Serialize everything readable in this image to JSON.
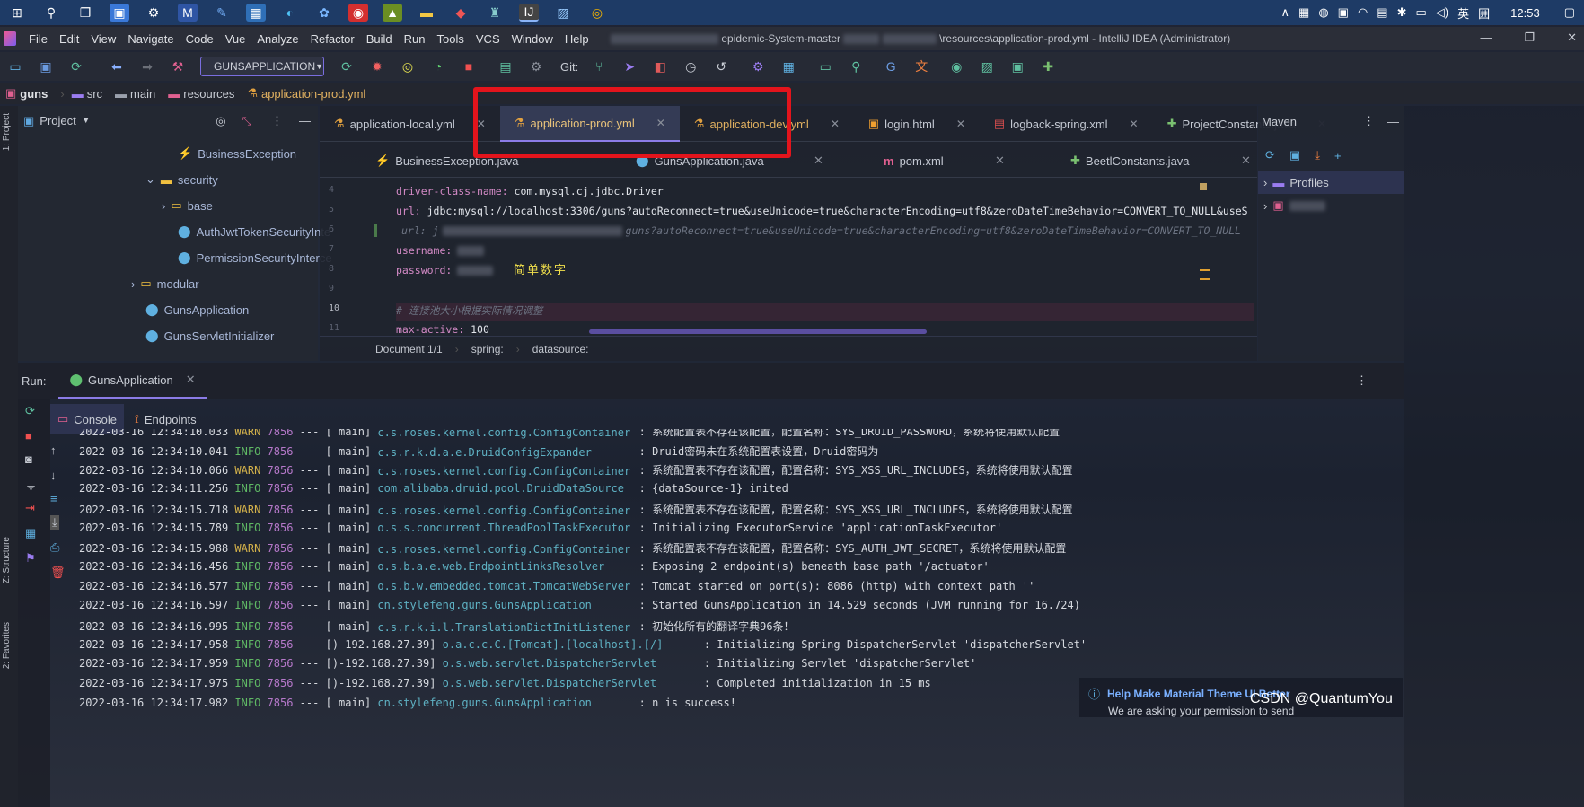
{
  "taskbar": {
    "tray": {
      "ime": "英",
      "time": "12:53"
    }
  },
  "menubar": {
    "items": [
      "File",
      "Edit",
      "View",
      "Navigate",
      "Code",
      "Vue",
      "Analyze",
      "Refactor",
      "Build",
      "Run",
      "Tools",
      "VCS",
      "Window",
      "Help"
    ],
    "title_fragment1": "epidemic-System-master",
    "title_fragment2": "\\resources\\application-prod.yml - IntelliJ IDEA (Administrator)"
  },
  "toolbar": {
    "run_config": "GUNSAPPLICATION",
    "git_label": "Git:"
  },
  "breadcrumb": [
    "guns",
    "src",
    "main",
    "resources",
    "application-prod.yml"
  ],
  "project": {
    "title": "Project",
    "strip_label": "1: Project",
    "nodes": [
      "BusinessException",
      "security",
      "base",
      "AuthJwtTokenSecurityInte",
      "PermissionSecurityInterce",
      "modular",
      "GunsApplication",
      "GunsServletInitializer"
    ]
  },
  "editor": {
    "tabs_row1": [
      {
        "label": "application-local.yml"
      },
      {
        "label": "application-prod.yml"
      },
      {
        "label": "application-dev.yml"
      },
      {
        "label": "login.html"
      },
      {
        "label": "logback-spring.xml"
      },
      {
        "label": "ProjectConstants.java"
      }
    ],
    "tabs_row2": [
      {
        "label": "BusinessException.java"
      },
      {
        "label": "GunsApplication.java"
      },
      {
        "label": "pom.xml"
      },
      {
        "label": "BeetlConstants.java"
      }
    ],
    "line_numbers": [
      "4",
      "5",
      "6",
      "7",
      "8",
      "9",
      "10",
      "11"
    ],
    "lines": [
      {
        "key": "driver-class-name:",
        "value": " com.mysql.cj.jdbc.Driver"
      },
      {
        "key": "url:",
        "value": " jdbc:mysql://localhost:3306/guns?autoReconnect=true&useUnicode=true&characterEncoding=utf8&zeroDateTimeBehavior=CONVERT_TO_NULL&useS"
      },
      {
        "comment": "url: j",
        "comment2": "guns?autoReconnect=true&useUnicode=true&characterEncoding=utf8&zeroDateTimeBehavior=CONVERT_TO_NULL"
      },
      {
        "key": "username:",
        "value": ""
      },
      {
        "key": "password:",
        "value": ""
      },
      {
        "key": "",
        "value": ""
      },
      {
        "comment": "# 连接池大小根据实际情况调整"
      },
      {
        "key": "max-active:",
        "value": " 100"
      }
    ],
    "overlay_note": "简单数字",
    "status": [
      "Document 1/1",
      "spring:",
      "datasource:"
    ]
  },
  "maven": {
    "title": "Maven",
    "profiles": "Profiles"
  },
  "run": {
    "label": "Run:",
    "config": "GunsApplication",
    "tabs": [
      "Console",
      "Endpoints"
    ],
    "strips": [
      "Z: Structure",
      "2: Favorites"
    ],
    "logs": [
      {
        "ts": "2022-03-16 12:34:10.033",
        "lvl": "WARN",
        "pid": "7856",
        "thr": "main",
        "cls": "c.s.roses.kernel.config.ConfigContainer",
        "msg": ": 系统配置表不存在该配置，配置名称：SYS_DRUID_PASSWORD，系统将使用默认配置"
      },
      {
        "ts": "2022-03-16 12:34:10.041",
        "lvl": "INFO",
        "pid": "7856",
        "thr": "main",
        "cls": "c.s.r.k.d.a.e.DruidConfigExpander",
        "msg": ": Druid密码未在系统配置表设置，Druid密码为"
      },
      {
        "ts": "2022-03-16 12:34:10.066",
        "lvl": "WARN",
        "pid": "7856",
        "thr": "main",
        "cls": "c.s.roses.kernel.config.ConfigContainer",
        "msg": ": 系统配置表不存在该配置，配置名称：SYS_XSS_URL_INCLUDES，系统将使用默认配置"
      },
      {
        "ts": "2022-03-16 12:34:11.256",
        "lvl": "INFO",
        "pid": "7856",
        "thr": "main",
        "cls": "com.alibaba.druid.pool.DruidDataSource",
        "msg": ": {dataSource-1} inited"
      },
      {
        "ts": "2022-03-16 12:34:15.718",
        "lvl": "WARN",
        "pid": "7856",
        "thr": "main",
        "cls": "c.s.roses.kernel.config.ConfigContainer",
        "msg": ": 系统配置表不存在该配置，配置名称：SYS_XSS_URL_INCLUDES，系统将使用默认配置"
      },
      {
        "ts": "2022-03-16 12:34:15.789",
        "lvl": "INFO",
        "pid": "7856",
        "thr": "main",
        "cls": "o.s.s.concurrent.ThreadPoolTaskExecutor",
        "msg": ": Initializing ExecutorService 'applicationTaskExecutor'"
      },
      {
        "ts": "2022-03-16 12:34:15.988",
        "lvl": "WARN",
        "pid": "7856",
        "thr": "main",
        "cls": "c.s.roses.kernel.config.ConfigContainer",
        "msg": ": 系统配置表不存在该配置，配置名称：SYS_AUTH_JWT_SECRET，系统将使用默认配置"
      },
      {
        "ts": "2022-03-16 12:34:16.456",
        "lvl": "INFO",
        "pid": "7856",
        "thr": "main",
        "cls": "o.s.b.a.e.web.EndpointLinksResolver",
        "msg": ": Exposing 2 endpoint(s) beneath base path '/actuator'"
      },
      {
        "ts": "2022-03-16 12:34:16.577",
        "lvl": "INFO",
        "pid": "7856",
        "thr": "main",
        "cls": "o.s.b.w.embedded.tomcat.TomcatWebServer",
        "msg": ": Tomcat started on port(s): 8086 (http) with context path ''"
      },
      {
        "ts": "2022-03-16 12:34:16.597",
        "lvl": "INFO",
        "pid": "7856",
        "thr": "main",
        "cls": "cn.stylefeng.guns.GunsApplication",
        "msg": ": Started GunsApplication in 14.529 seconds (JVM running for 16.724)"
      },
      {
        "ts": "2022-03-16 12:34:16.995",
        "lvl": "INFO",
        "pid": "7856",
        "thr": "main",
        "cls": "c.s.r.k.i.l.TranslationDictInitListener",
        "msg": ": 初始化所有的翻译字典96条！"
      },
      {
        "ts": "2022-03-16 12:34:17.958",
        "lvl": "INFO",
        "pid": "7856",
        "thr": ")-192.168.27.39",
        "cls": "o.a.c.c.C.[Tomcat].[localhost].[/]",
        "msg": ": Initializing Spring DispatcherServlet 'dispatcherServlet'"
      },
      {
        "ts": "2022-03-16 12:34:17.959",
        "lvl": "INFO",
        "pid": "7856",
        "thr": ")-192.168.27.39",
        "cls": "o.s.web.servlet.DispatcherServlet",
        "msg": ": Initializing Servlet 'dispatcherServlet'"
      },
      {
        "ts": "2022-03-16 12:34:17.975",
        "lvl": "INFO",
        "pid": "7856",
        "thr": ")-192.168.27.39",
        "cls": "o.s.web.servlet.DispatcherServlet",
        "msg": ": Completed initialization in 15 ms"
      },
      {
        "ts": "2022-03-16 12:34:17.982",
        "lvl": "INFO",
        "pid": "7856",
        "thr": "main",
        "cls": "cn.stylefeng.guns.GunsApplication",
        "msg": ": n is success!"
      }
    ]
  },
  "notification": {
    "title": "Help Make Material Theme UI Better",
    "body": "We are asking your permission to send"
  },
  "watermark": "CSDN @QuantumYou",
  "colors": {
    "highlight_box": "#e3141c",
    "info": "#5fb864",
    "warn": "#d3b14a",
    "accent": "#8b7be6"
  }
}
